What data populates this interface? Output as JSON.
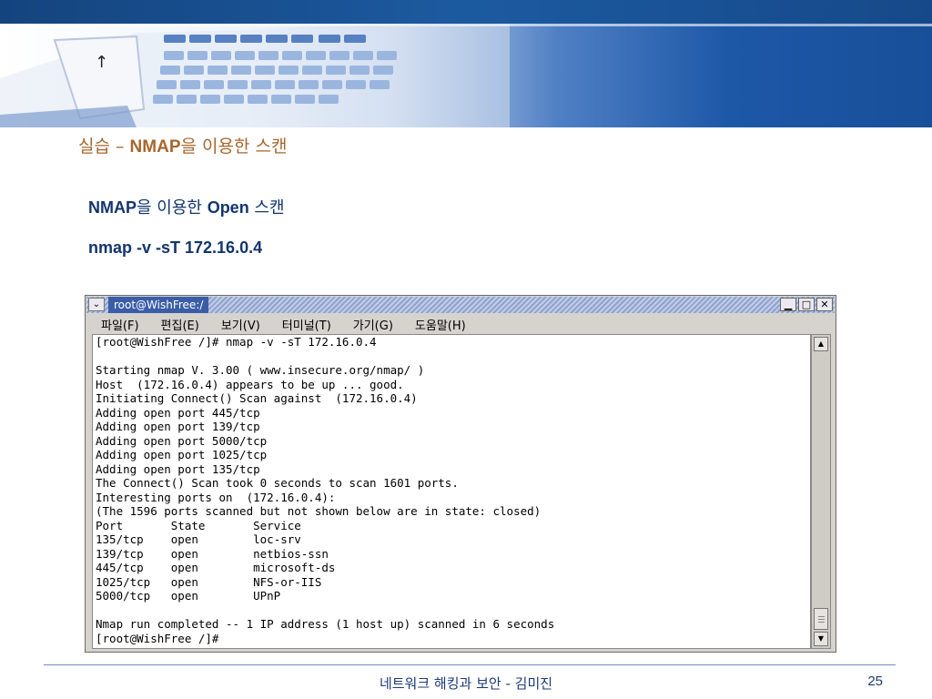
{
  "slide": {
    "title_prefix": "실습 – ",
    "title_bold": "NMAP",
    "title_suffix": "을 이용한 스캔",
    "subtitle1_bold": "NMAP",
    "subtitle1_mid": "을 이용한 ",
    "subtitle1_bold2": "Open",
    "subtitle1_end": " 스캔",
    "command": "nmap -v -sT 172.16.0.4",
    "footer": "네트워크 해킹과 보안  -  김미진",
    "page_number": "25"
  },
  "window": {
    "title": "root@WishFree:/",
    "menu": [
      {
        "label": "파일(F)",
        "shortcut": "F"
      },
      {
        "label": "편집(E)",
        "shortcut": "E"
      },
      {
        "label": "보기(V)",
        "shortcut": "V"
      },
      {
        "label": "터미널(T)",
        "shortcut": "T"
      },
      {
        "label": "가기(G)",
        "shortcut": "G"
      },
      {
        "label": "도움말(H)",
        "shortcut": "H"
      }
    ],
    "buttons": {
      "minimize": "▁",
      "maximize": "□",
      "close": "✕"
    },
    "terminal_lines": [
      "[root@WishFree /]# nmap -v -sT 172.16.0.4",
      "",
      "Starting nmap V. 3.00 ( www.insecure.org/nmap/ )",
      "Host  (172.16.0.4) appears to be up ... good.",
      "Initiating Connect() Scan against  (172.16.0.4)",
      "Adding open port 445/tcp",
      "Adding open port 139/tcp",
      "Adding open port 5000/tcp",
      "Adding open port 1025/tcp",
      "Adding open port 135/tcp",
      "The Connect() Scan took 0 seconds to scan 1601 ports.",
      "Interesting ports on  (172.16.0.4):",
      "(The 1596 ports scanned but not shown below are in state: closed)",
      "Port       State       Service",
      "135/tcp    open        loc-srv",
      "139/tcp    open        netbios-ssn",
      "445/tcp    open        microsoft-ds",
      "1025/tcp   open        NFS-or-IIS",
      "5000/tcp   open        UPnP",
      "",
      "Nmap run completed -- 1 IP address (1 host up) scanned in 6 seconds",
      "[root@WishFree /]#"
    ]
  },
  "colors": {
    "title_accent": "#a9662d",
    "subtitle": "#13356e",
    "banner_blue": "#1c5aa0",
    "window_title_bg": "#3b5da8"
  }
}
